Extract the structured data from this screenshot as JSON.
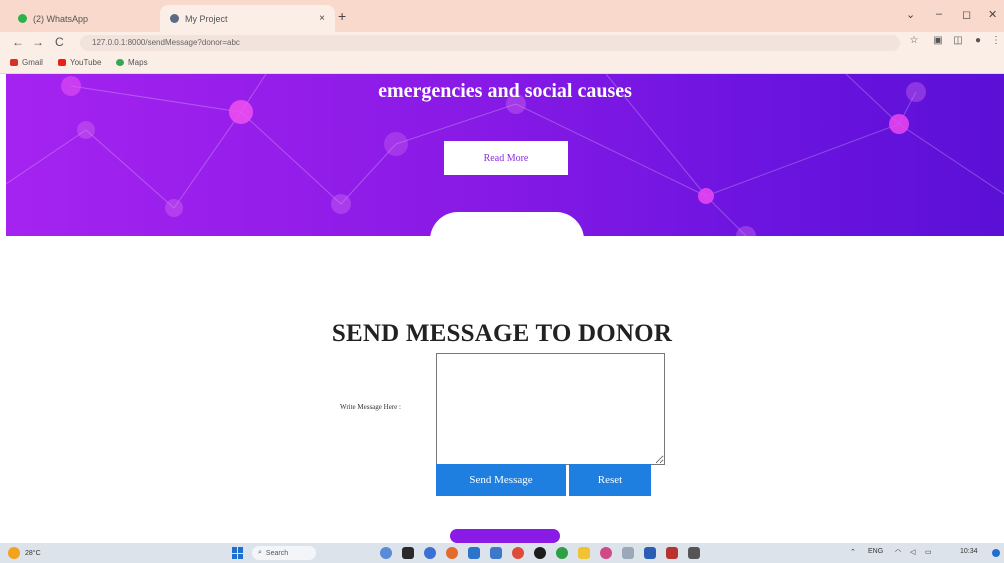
{
  "browser": {
    "tabs": [
      {
        "label": "(2) WhatsApp",
        "close": "×"
      },
      {
        "label": "My Project",
        "close": "×"
      }
    ],
    "new_tab": "+",
    "window_controls": [
      "⌄",
      "–",
      "◻",
      "✕"
    ],
    "url": "127.0.0.1:8000/sendMessage?donor=abc",
    "bookmarks": [
      "Gmail",
      "YouTube",
      "Maps"
    ],
    "nav": {
      "back": "←",
      "forward": "→",
      "reload": "C"
    }
  },
  "hero": {
    "text": "emergencies and social causes",
    "read_more_label": "Read More"
  },
  "form": {
    "title": "SEND MESSAGE TO DONOR",
    "message_label": "Write Message Here :",
    "message_value": "",
    "send_label": "Send Message",
    "reset_label": "Reset"
  },
  "taskbar": {
    "weather": "28°C",
    "search_placeholder": "Search",
    "lang": "ENG",
    "time": "10:34"
  },
  "colors": {
    "hero_start": "#a523f0",
    "hero_end": "#5b10d6",
    "button_blue": "#1e7fe0",
    "tab_bar": "#f8d9cc"
  }
}
